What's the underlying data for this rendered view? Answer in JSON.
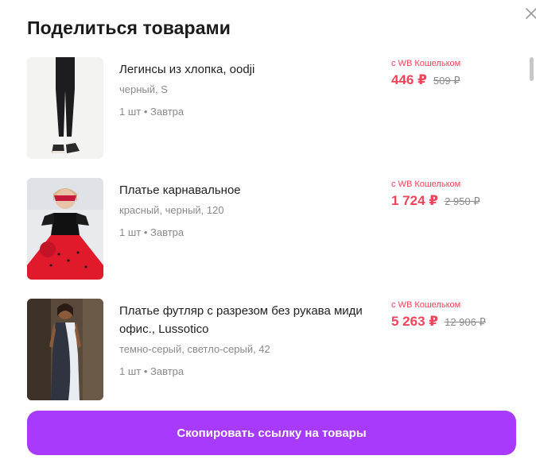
{
  "dialog": {
    "title": "Поделиться товарами",
    "close_icon": "close-icon"
  },
  "items": [
    {
      "name": "Легинсы из хлопка, oodji",
      "variant": "черный, S",
      "quantity_delivery": "1 шт • Завтра",
      "wallet_label": "с WB Кошельком",
      "price": "446 ₽",
      "old_price": "509 ₽"
    },
    {
      "name": "Платье карнавальное",
      "variant": "красный, черный, 120",
      "quantity_delivery": "1 шт • Завтра",
      "wallet_label": "с WB Кошельком",
      "price": "1 724 ₽",
      "old_price": "2 950 ₽"
    },
    {
      "name": "Платье футляр с разрезом без рукава миди офис., Lussotico",
      "variant": "темно-серый, светло-серый, 42",
      "quantity_delivery": "1 шт • Завтра",
      "wallet_label": "с WB Кошельком",
      "price": "5 263 ₽",
      "old_price": "12 906 ₽"
    }
  ],
  "footer": {
    "copy_button_label": "Скопировать ссылку на товары"
  },
  "colors": {
    "accent": "#a73afd",
    "price": "#f0445a",
    "muted": "#8a8a8a"
  }
}
